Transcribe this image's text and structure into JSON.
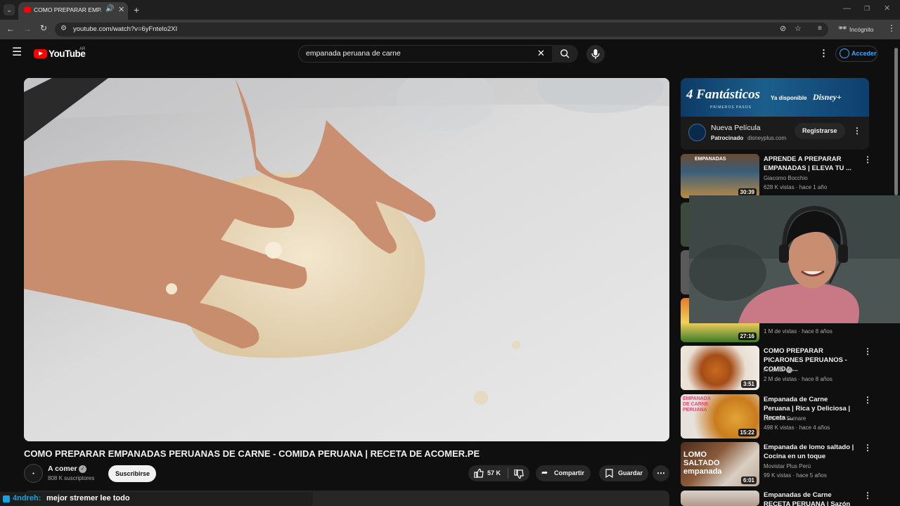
{
  "browser": {
    "tab_title": "COMO PREPARAR EMPANADAS",
    "url": "youtube.com/watch?v=6yFntelo2XI",
    "incognito_label": "Incógnito"
  },
  "youtube": {
    "logo_text": "YouTube",
    "region": "AR",
    "search_value": "empanada peruana de carne",
    "login_label": "Acceder"
  },
  "video": {
    "title": "COMO PREPARAR EMPANADAS PERUANAS DE CARNE - COMIDA PERUANA | RECETA DE ACOMER.PE",
    "channel_name": "A comer",
    "subscribers": "808 K suscriptores",
    "subscribe_label": "Suscribirse",
    "likes": "57 K",
    "share_label": "Compartir",
    "save_label": "Guardar"
  },
  "ad": {
    "banner_title": "4 Fantásticos",
    "banner_subtitle": "PRIMEROS PASOS",
    "banner_available": "Ya disponible",
    "banner_brand": "Disney+",
    "title": "Nueva Película",
    "sponsored": "Patrocinado",
    "domain": "disneyplus.com",
    "cta": "Registrarse"
  },
  "recommendations": [
    {
      "title": "APRENDE A PREPARAR EMPANADAS | ELEVA TU ...",
      "channel": "Giacomo Bocchio",
      "meta": "628 K vistas · hace 1 año",
      "duration": "30:39",
      "thumb_text": "EMPANADAS"
    },
    {
      "title": "",
      "channel": "",
      "meta": "1 M de vistas · hace 8 años",
      "duration": "27:16",
      "thumb_text": ""
    },
    {
      "title": "COMO PREPARAR PICARONES PERUANOS - COMIDA ...",
      "channel": "A comer",
      "meta": "2 M de vistas · hace 8 años",
      "duration": "3:51",
      "thumb_text": ""
    },
    {
      "title": "Empanada de Carne Peruana | Rica y Deliciosa | Receta ...",
      "channel": "La Cheff Sumare",
      "meta": "498 K vistas · hace 4 años",
      "duration": "15:22",
      "thumb_text": "EMPANADA DE CARNE PERUANA"
    },
    {
      "title": "Empanada de lomo saltado | Cocina en un toque",
      "channel": "Movistar Plus Perú",
      "meta": "99 K vistas · hace 5 años",
      "duration": "6:01",
      "thumb_text": "LOMO SALTADO empanada"
    },
    {
      "title": "Empanadas de Carne RECETA PERUANA | Sazón y Corazón",
      "channel": "",
      "meta": "",
      "duration": "",
      "thumb_text": ""
    }
  ],
  "chat_overlay": {
    "username": "4ndreh:",
    "message": "mejor stremer lee todo"
  }
}
